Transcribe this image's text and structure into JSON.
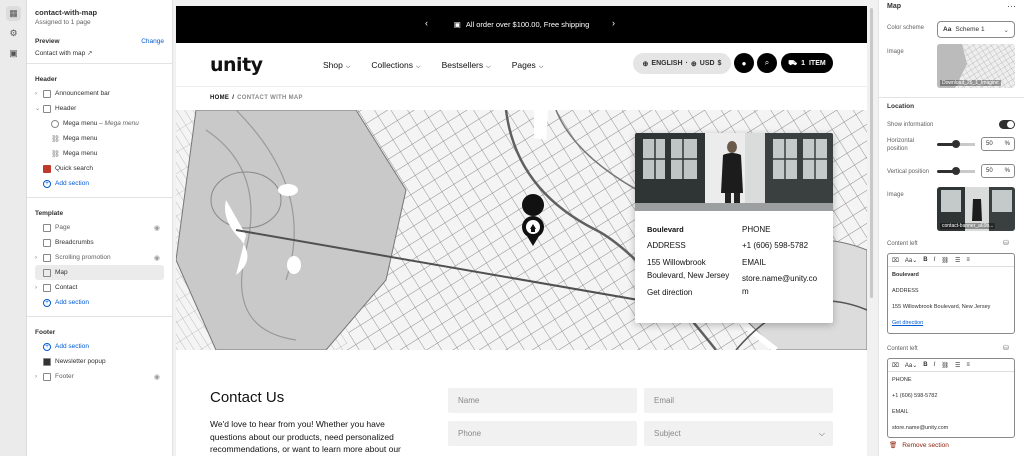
{
  "left": {
    "title": "contact-with-map",
    "assigned": "Assigned to 1 page",
    "preview_label": "Preview",
    "preview_change": "Change",
    "preview_page": "Contact with map",
    "header_section": "Header",
    "header_items": [
      {
        "label": "Announcement bar"
      },
      {
        "label": "Header"
      },
      {
        "label": "Mega menu",
        "suffix": "– Mega menu"
      },
      {
        "label": "Mega menu"
      },
      {
        "label": "Mega menu"
      },
      {
        "label": "Quick search"
      }
    ],
    "add_section": "Add section",
    "template_section": "Template",
    "template_items": [
      {
        "label": "Page"
      },
      {
        "label": "Breadcrumbs"
      },
      {
        "label": "Scrolling promotion"
      },
      {
        "label": "Map"
      },
      {
        "label": "Contact"
      }
    ],
    "footer_section": "Footer",
    "footer_items": [
      {
        "label": "Newsletter popup"
      },
      {
        "label": "Footer"
      }
    ]
  },
  "store": {
    "announcement": "All order over $100.00, Free shipping",
    "logo": "unity",
    "nav": [
      "Shop",
      "Collections",
      "Bestsellers",
      "Pages"
    ],
    "lang": "ENGLISH",
    "currency": "USD",
    "currency_symbol": "$",
    "cart_count": "1",
    "cart_label": "ITEM",
    "breadcrumb_home": "HOME",
    "breadcrumb_current": "CONTACT WITH MAP"
  },
  "map_card": {
    "title": "Boulevard",
    "address_label": "ADDRESS",
    "address": "155 Willowbrook Boulevard, New Jersey",
    "directions": "Get direction",
    "phone_label": "PHONE",
    "phone": "+1 (606) 598-5782",
    "email_label": "EMAIL",
    "email": "store.name@unity.com"
  },
  "contact": {
    "heading": "Contact Us",
    "body": "We'd love to hear from you! Whether you have questions about our products, need personalized recommendations, or want to learn more about our",
    "fields": {
      "name": "Name",
      "email": "Email",
      "phone": "Phone",
      "subject": "Subject"
    }
  },
  "right": {
    "title": "Map",
    "color_scheme_label": "Color scheme",
    "color_scheme_value": "Scheme 1",
    "image_label": "Image",
    "image_caption": "Download_26_1_Imagine",
    "location_heading": "Location",
    "show_info_label": "Show information",
    "horizontal_label": "Horizontal position",
    "horizontal_value": "50",
    "vertical_label": "Vertical position",
    "vertical_value": "50",
    "unit": "%",
    "image2_label": "Image",
    "image2_caption": "contact-banner_a69b...",
    "content_left_label": "Content left",
    "content_left_1": {
      "title": "Boulevard",
      "line1": "ADDRESS",
      "line2": "155 Willowbrook Boulevard, New Jersey",
      "link": "Get direction"
    },
    "content_left_label_2": "Content left",
    "content_left_2": {
      "l1": "PHONE",
      "l2": "+1 (606) 598-5782",
      "l3": "EMAIL",
      "l4": "store.name@unity.com"
    },
    "remove_section": "Remove section"
  }
}
